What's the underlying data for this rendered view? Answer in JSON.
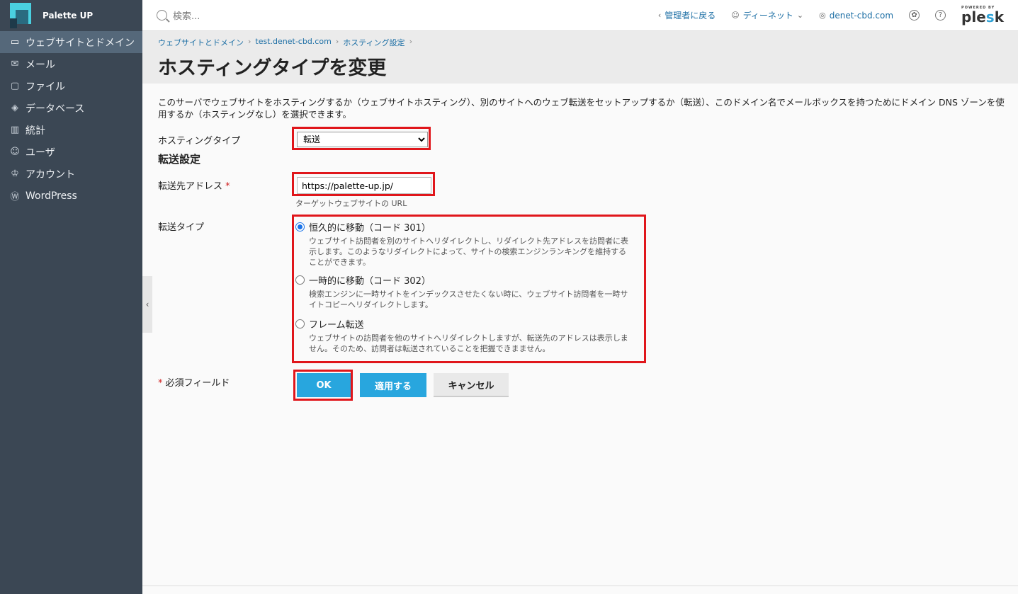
{
  "app": {
    "name": "Palette UP"
  },
  "sidebar": {
    "items": [
      {
        "label": "ウェブサイトとドメイン",
        "icon": "monitor-icon",
        "active": true
      },
      {
        "label": "メール",
        "icon": "mail-icon",
        "active": false
      },
      {
        "label": "ファイル",
        "icon": "folder-icon",
        "active": false
      },
      {
        "label": "データベース",
        "icon": "database-icon",
        "active": false
      },
      {
        "label": "統計",
        "icon": "bar-chart-icon",
        "active": false
      },
      {
        "label": "ユーザ",
        "icon": "user-icon",
        "active": false
      },
      {
        "label": "アカウント",
        "icon": "account-icon",
        "active": false
      },
      {
        "label": "WordPress",
        "icon": "wordpress-icon",
        "active": false
      }
    ]
  },
  "topbar": {
    "search_placeholder": "検索...",
    "back_to_admin": "管理者に戻る",
    "user": "ディーネット",
    "domain": "denet-cbd.com",
    "powered_by": "POWERED BY",
    "brand": "plesk"
  },
  "breadcrumb": [
    "ウェブサイトとドメイン",
    "test.denet-cbd.com",
    "ホスティング設定"
  ],
  "page_title": "ホスティングタイプを変更",
  "intro": "このサーバでウェブサイトをホスティングするか（ウェブサイトホスティング）、別のサイトへのウェブ転送をセットアップするか（転送）、このドメイン名でメールボックスを持つためにドメイン DNS ゾーンを使用するか（ホスティングなし）を選択できます。",
  "form": {
    "hosting_type_label": "ホスティングタイプ",
    "hosting_type_value": "転送",
    "section_title": "転送設定",
    "dest_label": "転送先アドレス",
    "required_mark": "*",
    "dest_value": "https://palette-up.jp/",
    "dest_hint": "ターゲットウェブサイトの URL",
    "redirect_type_label": "転送タイプ",
    "options": [
      {
        "label": "恒久的に移動（コード 301）",
        "desc": "ウェブサイト訪問者を別のサイトへリダイレクトし、リダイレクト先アドレスを訪問者に表示します。このようなリダイレクトによって、サイトの検索エンジンランキングを維持することができます。",
        "selected": true
      },
      {
        "label": "一時的に移動（コード 302）",
        "desc": "検索エンジンに一時サイトをインデックスさせたくない時に、ウェブサイト訪問者を一時サイトコピーへリダイレクトします。",
        "selected": false
      },
      {
        "label": "フレーム転送",
        "desc": "ウェブサイトの訪問者を他のサイトへリダイレクトしますが、転送先のアドレスは表示しません。そのため、訪問者は転送されていることを把握できまません。",
        "selected": false
      }
    ],
    "required_note": "必須フィールド",
    "ok": "OK",
    "apply": "適用する",
    "cancel": "キャンセル"
  },
  "colors": {
    "highlight": "#e0161b",
    "button": "#28a6de",
    "sidebar": "#3b4754"
  }
}
